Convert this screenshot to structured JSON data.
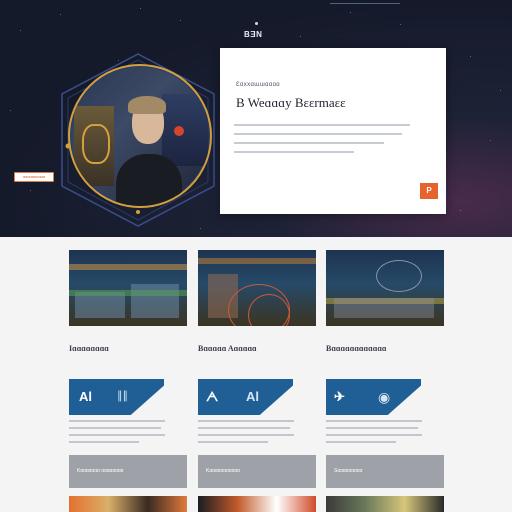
{
  "header": {
    "brand_mark": "BƎN",
    "top_dot": "•"
  },
  "hero": {
    "eyebrow": "Ɛɑxxɑɯɯɑɑɑɑ",
    "title": "B Weɑɑɑy Bɛɛrmaɛɛ",
    "body": "",
    "button_label": "ɑɑɑɑɑɑɑɑɑɑ",
    "cta_label": "P"
  },
  "features": [
    {
      "caption": "Iɑɑɑɑɑɑɑɑ",
      "icon": "al-stat-icon",
      "glyph": "Al",
      "glyph2": "∥∥"
    },
    {
      "caption": "Bɑɑɑɑɑ Aɑɑɑɑɑ",
      "icon": "robot-arm-icon",
      "glyph": "ᗅ",
      "glyph2": "Al"
    },
    {
      "caption": "Bɑɑɑɑɑɑɑɑɑɑɑɑ",
      "icon": "running-figure-icon",
      "glyph": "✈",
      "glyph2": "◉"
    }
  ],
  "bars": [
    {
      "label": "Kɑɑɑɑɑɑɑ ɑɑɑɑɑɑɑɑ"
    },
    {
      "label": "Kɑɑɑɑɑɑɑɑɑɑɑ"
    },
    {
      "label": "Sɑɑɑɑɑɑɑɑɑ"
    }
  ],
  "colors": {
    "hero_bg": "#151a2b",
    "accent_gold": "#d3a03a",
    "accent_orange": "#e8632b",
    "feature_blue": "#1f5f96",
    "bar_gray": "#9ea1a7"
  }
}
